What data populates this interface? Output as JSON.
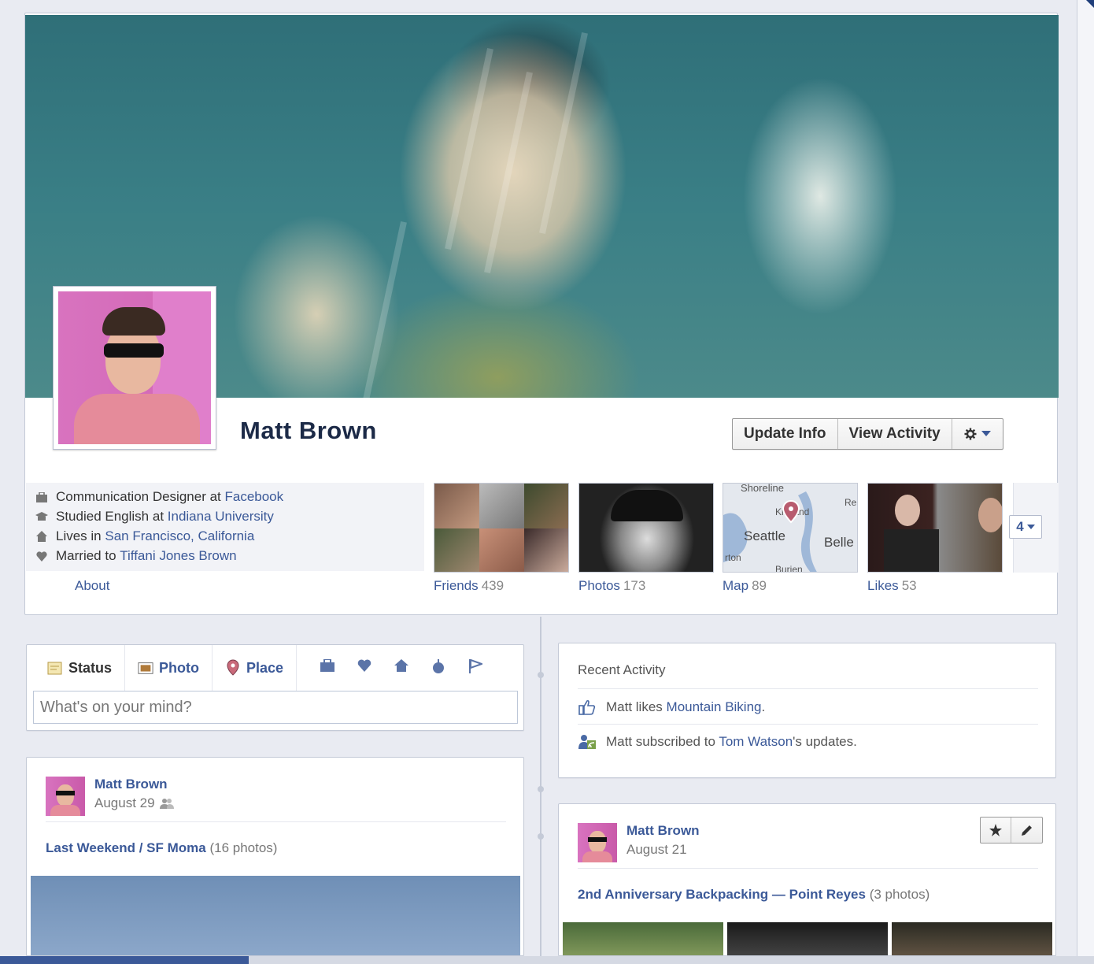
{
  "profile": {
    "name": "Matt Brown",
    "actions": {
      "update_info": "Update Info",
      "view_activity": "View Activity"
    },
    "gear_icon": "gear-icon"
  },
  "about": {
    "lines": [
      {
        "icon": "briefcase-icon",
        "prefix": "Communication Designer at ",
        "link": "Facebook"
      },
      {
        "icon": "graduation-cap-icon",
        "prefix": "Studied English at ",
        "link": "Indiana University"
      },
      {
        "icon": "house-icon",
        "prefix": "Lives in ",
        "link": "San Francisco, California"
      },
      {
        "icon": "heart-icon",
        "prefix": "Married to ",
        "link": "Tiffani Jones Brown"
      }
    ],
    "label": "About"
  },
  "tiles": [
    {
      "label": "Friends",
      "count": "439"
    },
    {
      "label": "Photos",
      "count": "173"
    },
    {
      "label": "Map",
      "count": "89",
      "map_labels": [
        "Shoreline",
        "Kirkland",
        "Seattle",
        "Belle",
        "rton",
        "Burien",
        "Re"
      ]
    },
    {
      "label": "Likes",
      "count": "53"
    }
  ],
  "more": {
    "count": "4"
  },
  "composer": {
    "tabs": [
      {
        "label": "Status",
        "icon": "status-icon"
      },
      {
        "label": "Photo",
        "icon": "photo-icon"
      },
      {
        "label": "Place",
        "icon": "place-pin-icon"
      }
    ],
    "extra_icons": [
      "briefcase-icon",
      "heart-icon",
      "house-icon",
      "apple-icon",
      "flag-icon"
    ],
    "placeholder": "What's on your mind?"
  },
  "recent_activity": {
    "title": "Recent Activity",
    "items": [
      {
        "icon": "like-icon",
        "prefix": "Matt likes ",
        "link": "Mountain Biking",
        "suffix": "."
      },
      {
        "icon": "subscribe-icon",
        "prefix": "Matt subscribed to ",
        "link": "Tom Watson",
        "suffix": "'s updates."
      }
    ]
  },
  "posts": [
    {
      "author": "Matt Brown",
      "date": "August 29",
      "audience_icon": "friends-icon",
      "album_title": "Last Weekend / SF Moma",
      "album_count": "(16 photos)"
    },
    {
      "author": "Matt Brown",
      "date": "August 21",
      "album_title": "2nd Anniversary Backpacking — Point Reyes",
      "album_count": "(3 photos)",
      "tools": [
        "star-icon",
        "pencil-icon"
      ]
    }
  ]
}
